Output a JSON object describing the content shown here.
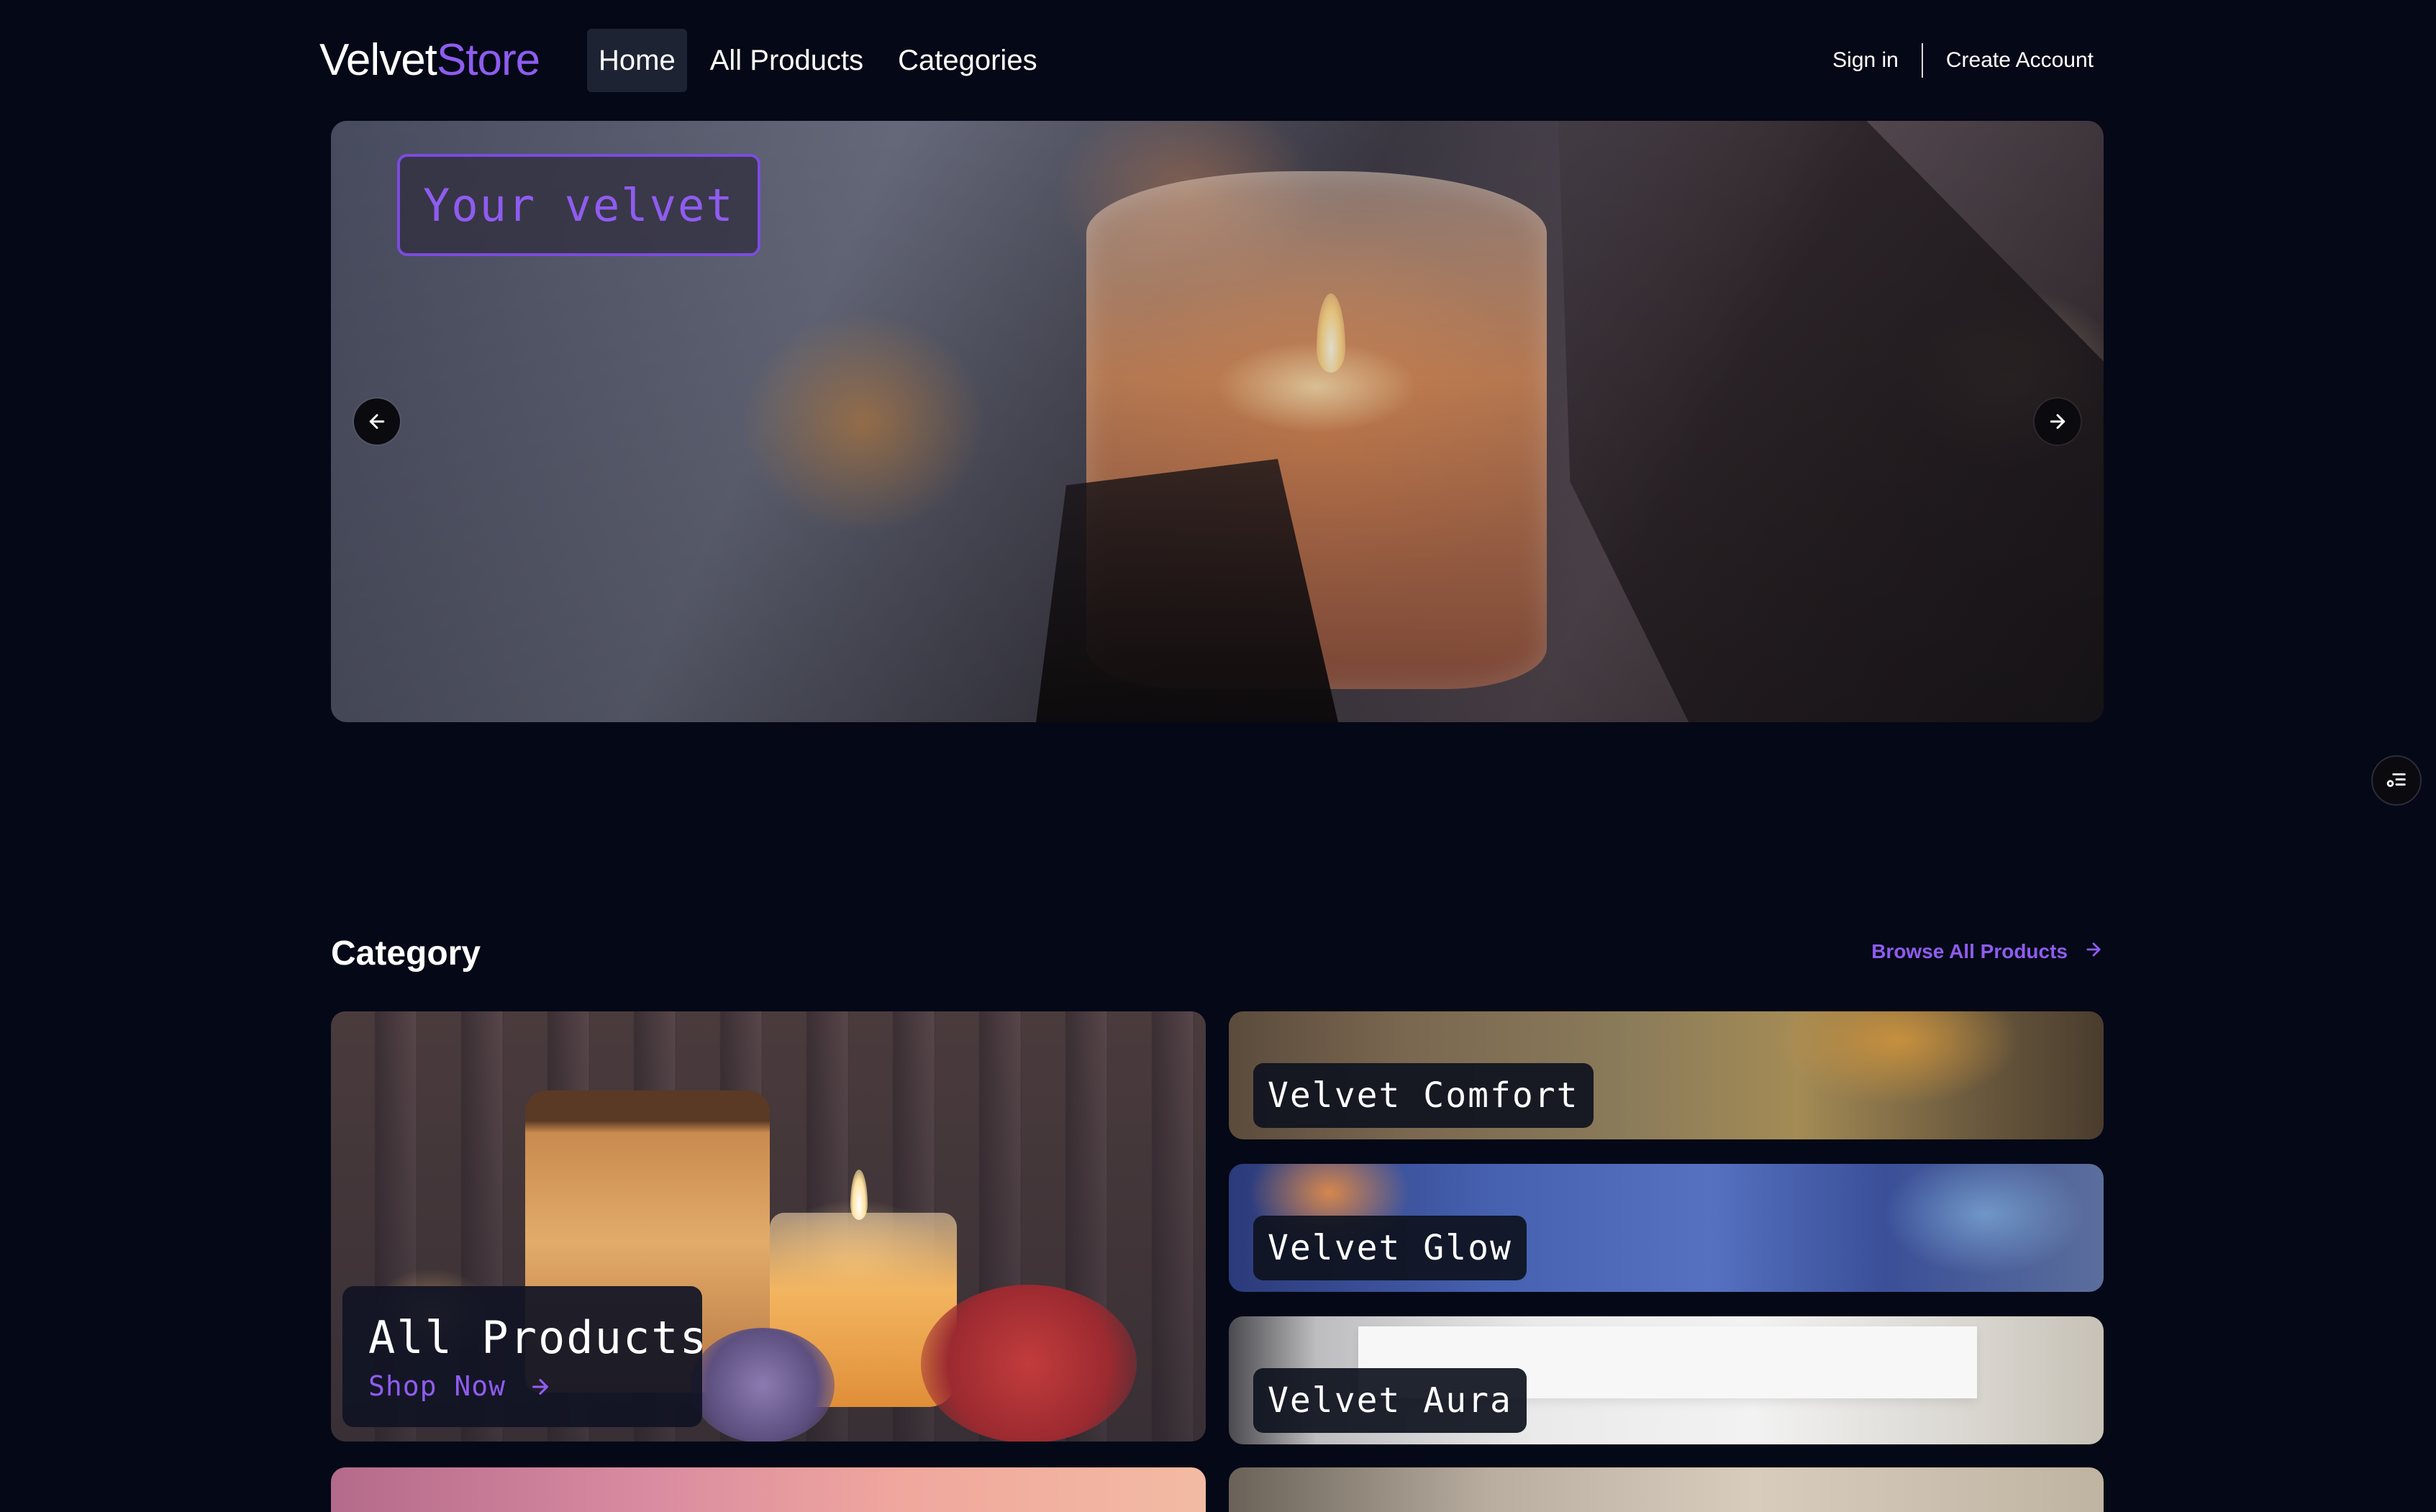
{
  "header": {
    "logo_part1": "Velvet",
    "logo_part2": "Store",
    "nav": [
      {
        "label": "Home",
        "active": true
      },
      {
        "label": "All Products",
        "active": false
      },
      {
        "label": "Categories",
        "active": false
      }
    ],
    "sign_in": "Sign in",
    "create_account": "Create Account"
  },
  "hero": {
    "caption": "Your velvet",
    "prev_icon": "arrow-left-icon",
    "next_icon": "arrow-right-icon"
  },
  "float_widget": {
    "icon": "filter-list-icon"
  },
  "category": {
    "title": "Category",
    "browse_label": "Browse All Products",
    "browse_icon": "arrow-right-icon",
    "featured": {
      "title": "All Products",
      "cta": "Shop Now",
      "cta_icon": "arrow-right-icon"
    },
    "items": [
      {
        "title": "Velvet Comfort"
      },
      {
        "title": "Velvet Glow"
      },
      {
        "title": "Velvet Aura"
      }
    ]
  },
  "colors": {
    "background": "#050816",
    "accent": "#8f5cf0",
    "nav_active_bg": "#1d2332",
    "label_bg": "#10142a"
  }
}
